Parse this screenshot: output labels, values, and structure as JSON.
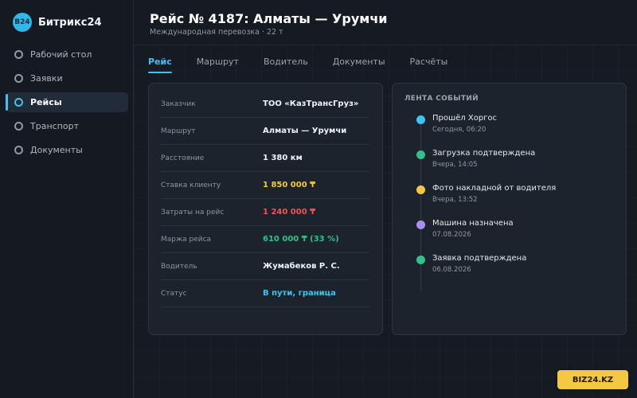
{
  "brand": {
    "logo_text": "B24",
    "name": "Битрикс24"
  },
  "sidebar": {
    "items": [
      {
        "label": "Рабочий стол",
        "active": false
      },
      {
        "label": "Заявки",
        "active": false
      },
      {
        "label": "Рейсы",
        "active": true
      },
      {
        "label": "Транспорт",
        "active": false
      },
      {
        "label": "Документы",
        "active": false
      }
    ]
  },
  "header": {
    "title": "Рейс № 4187: Алматы — Урумчи",
    "subtitle": "Международная перевозка · 22 т"
  },
  "tabs": [
    {
      "label": "Рейс",
      "active": true
    },
    {
      "label": "Маршрут",
      "active": false
    },
    {
      "label": "Водитель",
      "active": false
    },
    {
      "label": "Документы",
      "active": false
    },
    {
      "label": "Расчёты",
      "active": false
    }
  ],
  "details": {
    "rows": [
      {
        "label": "Заказчик",
        "value": "ТОО «КазТрансГруз»",
        "tone": ""
      },
      {
        "label": "Маршрут",
        "value": "Алматы — Урумчи",
        "tone": ""
      },
      {
        "label": "Расстояние",
        "value": "1 380 км",
        "tone": ""
      },
      {
        "label": "Ставка клиенту",
        "value": "1 850 000 ₸",
        "tone": "yellow"
      },
      {
        "label": "Затраты на рейс",
        "value": "1 240 000 ₸",
        "tone": "red"
      },
      {
        "label": "Маржа рейса",
        "value": "610 000 ₸ (33 %)",
        "tone": "green"
      },
      {
        "label": "Водитель",
        "value": "Жумабеков Р. С.",
        "tone": ""
      },
      {
        "label": "Статус",
        "value": "В пути, граница",
        "tone": "blue"
      }
    ]
  },
  "feed": {
    "title": "ЛЕНТА СОБЫТИЙ",
    "events": [
      {
        "title": "Прошёл Хоргос",
        "time": "Сегодня, 06:20",
        "color": "#3cc4f2"
      },
      {
        "title": "Загрузка подтверждена",
        "time": "Вчера, 14:05",
        "color": "#2fc187"
      },
      {
        "title": "Фото накладной от водителя",
        "time": "Вчера, 13:52",
        "color": "#f5c842"
      },
      {
        "title": "Машина назначена",
        "time": "07.08.2026",
        "color": "#a98ef0"
      },
      {
        "title": "Заявка подтверждена",
        "time": "06.08.2026",
        "color": "#2fc187"
      }
    ]
  },
  "badge": {
    "label": "BIZ24.KZ"
  },
  "colors": {
    "accent": "#3cc4f2",
    "yellow": "#f5c842",
    "red": "#ef5454",
    "green": "#2fc187",
    "purple": "#a98ef0"
  }
}
